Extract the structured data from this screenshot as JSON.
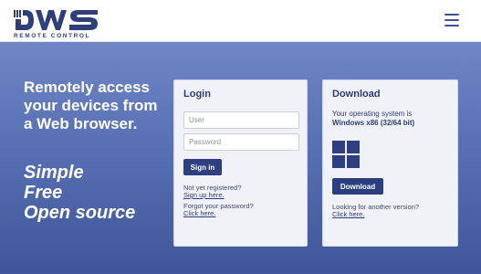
{
  "header": {
    "logo_text": "DWS",
    "logo_subtitle": "REMOTE CONTROL",
    "menu_icon": "hamburger-menu-icon"
  },
  "hero": {
    "tagline": "Remotely access your devices from a Web browser.",
    "slogan": [
      "Simple",
      "Free",
      "Open source"
    ]
  },
  "login": {
    "title": "Login",
    "user_placeholder": "User",
    "password_placeholder": "Password",
    "signin_label": "Sign in",
    "not_registered": "Not yet registered?",
    "signup_link": "Sign up here.",
    "forgot_password": "Forgot your password?",
    "forgot_link": "Click here."
  },
  "download": {
    "title": "Download",
    "os_label": "Your operating system is",
    "os_name": "Windows x86 (32/64 bit)",
    "os_icon": "windows-logo-icon",
    "download_label": "Download",
    "another_version": "Looking for another version?",
    "another_link": "Click here."
  },
  "colors": {
    "brand_dark": "#2d3f7f",
    "hero_top": "#6f86c4",
    "hero_bottom": "#3f5699",
    "card_bg": "#f1f2f7"
  }
}
